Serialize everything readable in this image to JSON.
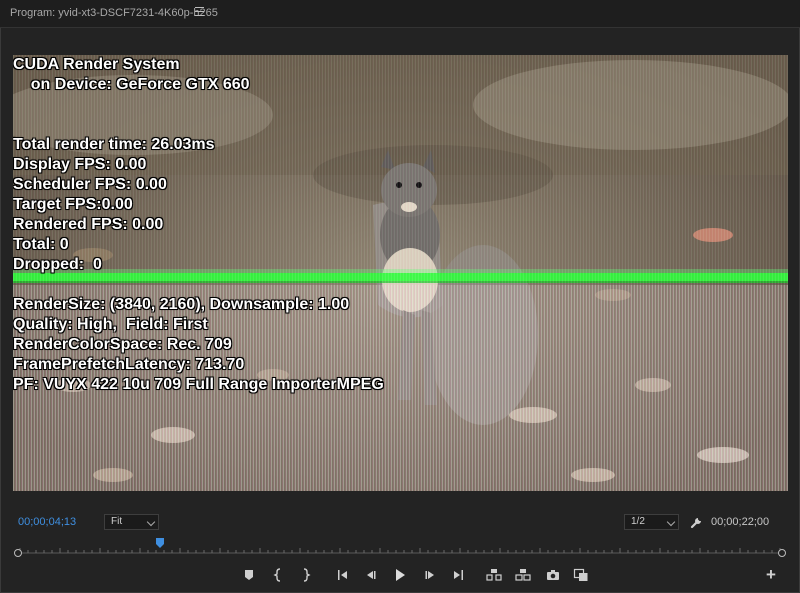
{
  "window": {
    "title": "Program: yvid-xt3-DSCF7231-4K60p-h265"
  },
  "overlay": {
    "lines": [
      "CUDA Render System",
      "    on Device: GeForce GTX 660",
      "Total render time: 26.03ms",
      "Display FPS: 0.00",
      "Scheduler FPS: 0.00",
      "Target FPS:0.00",
      "Rendered FPS: 0.00",
      "Total: 0",
      "Dropped:  0",
      "RenderSize: (3840, 2160), Downsample: 1.00",
      "Quality: High,  Field: First",
      "RenderColorSpace: Rec. 709",
      "FramePrefetchLatency: 713.70",
      "PF: VUYX 422 10u 709 Full Range ImporterMPEG"
    ]
  },
  "controls": {
    "current_timecode": "00;00;04;13",
    "zoom_select": "Fit",
    "resolution_select": "1/2",
    "duration_timecode": "00;00;22;00",
    "accent_color": "#3f8fe0"
  },
  "icons": {
    "menu": "hamburger-menu-icon",
    "wrench": "wrench-icon",
    "marker": "add-marker-icon",
    "mark_in": "mark-in-icon",
    "mark_out": "mark-out-icon",
    "go_to_in": "go-to-in-icon",
    "step_back": "step-back-icon",
    "play": "play-icon",
    "step_forward": "step-forward-icon",
    "go_to_out": "go-to-out-icon",
    "lift": "lift-icon",
    "extract": "extract-icon",
    "export_frame": "camera-icon",
    "compare": "comparison-view-icon",
    "button_editor": "plus-icon"
  }
}
